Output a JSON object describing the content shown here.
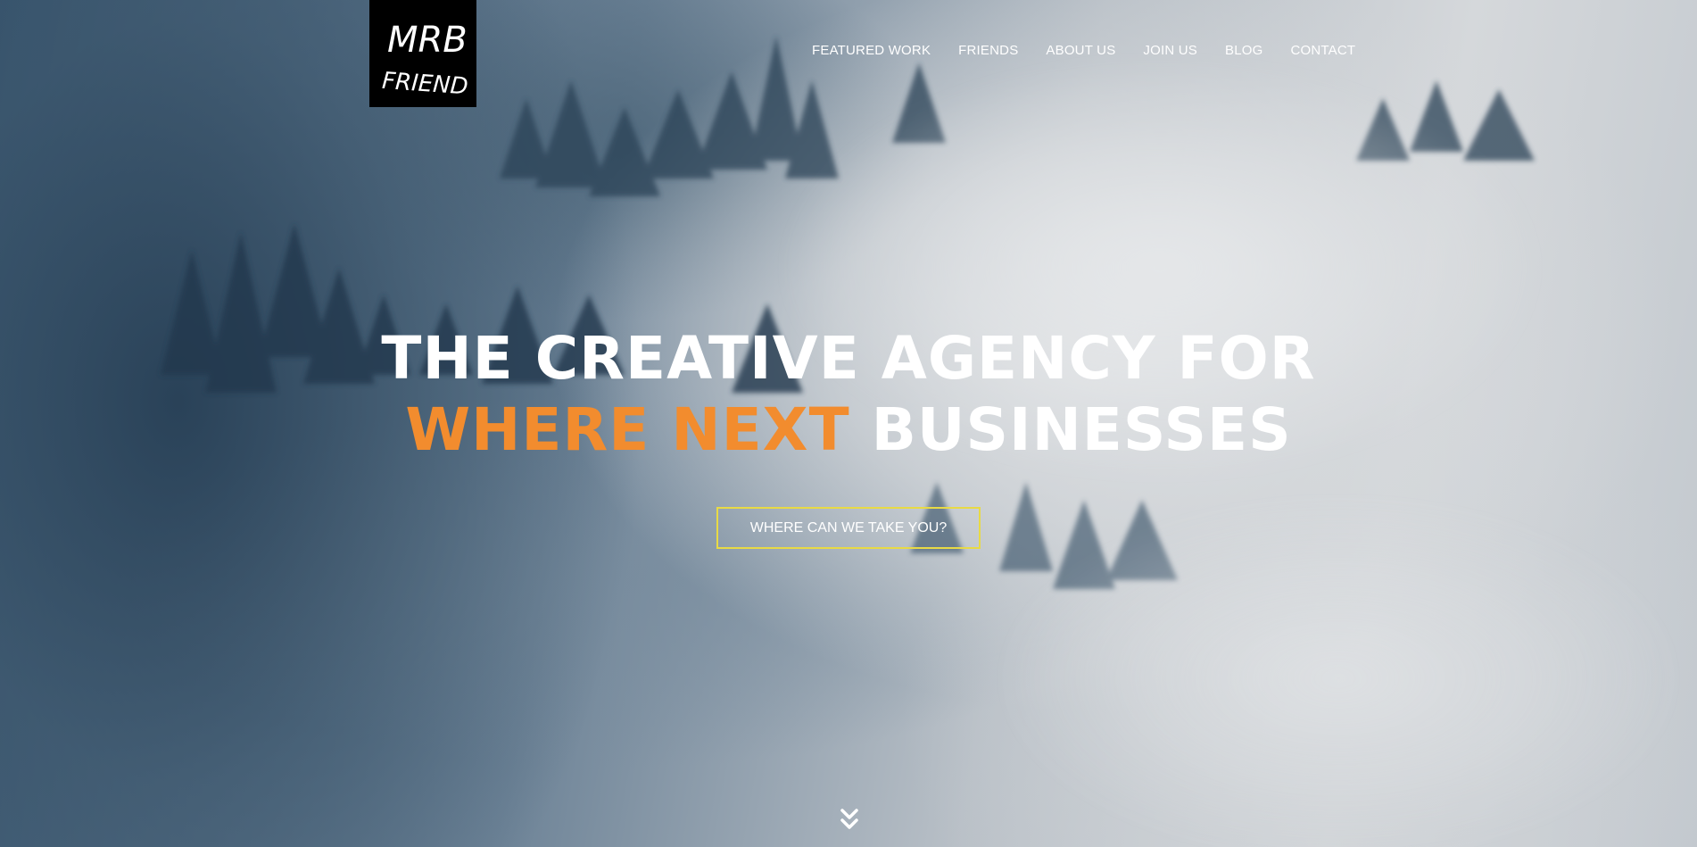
{
  "brand": {
    "logo_text_line1": "MRB",
    "logo_text_line2": "FRIEND"
  },
  "nav": {
    "items": [
      {
        "label": "FEATURED WORK"
      },
      {
        "label": "FRIENDS"
      },
      {
        "label": "ABOUT US"
      },
      {
        "label": "JOIN US"
      },
      {
        "label": "BLOG"
      },
      {
        "label": "CONTACT"
      }
    ]
  },
  "hero": {
    "headline_line1": "THE CREATIVE AGENCY FOR",
    "headline_accent": "WHERE NEXT",
    "headline_rest": "BUSINESSES",
    "cta_label": "WHERE CAN WE TAKE YOU?"
  },
  "icons": {
    "scroll": "double-chevron-down-icon"
  },
  "colors": {
    "accent": "#f28c2e",
    "cta_border": "#e8da45",
    "text": "#ffffff",
    "logo_bg": "#000000"
  }
}
